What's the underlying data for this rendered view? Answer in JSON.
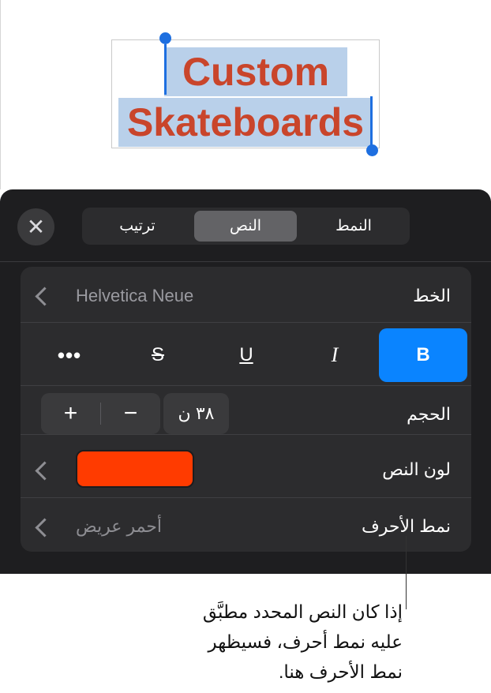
{
  "canvas": {
    "title_line1": "Custom",
    "title_line2": "Skateboards",
    "title_color": "#c9452b",
    "selection_color": "#b9d0ea",
    "handle_color": "#1e6fe0"
  },
  "panel": {
    "close_icon": "close-icon",
    "tabs": [
      {
        "label": "ترتيب",
        "selected": false
      },
      {
        "label": "النص",
        "selected": true
      },
      {
        "label": "النمط",
        "selected": false
      }
    ],
    "font": {
      "label": "الخط",
      "value": "Helvetica Neue"
    },
    "styles": {
      "bold": "B",
      "italic": "I",
      "underline": "U",
      "strikethrough": "S",
      "more": "•••",
      "bold_active": true
    },
    "size": {
      "label": "الحجم",
      "value": "٣٨ ن",
      "increase": "+",
      "decrease": "−"
    },
    "text_color": {
      "label": "لون النص",
      "swatch": "#ff3b00"
    },
    "character_style": {
      "label": "نمط الأحرف",
      "value": "أحمر عريض"
    },
    "accent_color": "#0a84ff"
  },
  "callout": {
    "lines": [
      "إذا كان النص المحدد مطبَّق",
      "عليه نمط أحرف، فسيظهر",
      "نمط الأحرف هنا."
    ]
  }
}
